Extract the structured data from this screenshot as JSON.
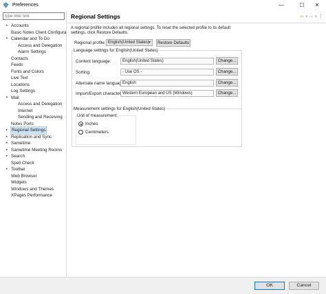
{
  "window": {
    "title": "Preferences",
    "minimize": "—",
    "maximize": "☐",
    "close": "✕"
  },
  "sidebar": {
    "filter_placeholder": "type filter text",
    "items": [
      {
        "label": "Accounts",
        "level": 1,
        "expander": "collapsed"
      },
      {
        "label": "Basic Notes Client Configura",
        "level": 1,
        "expander": "none"
      },
      {
        "label": "Calendar and To Do",
        "level": 1,
        "expander": "expanded"
      },
      {
        "label": "Access and Delegation",
        "level": 2,
        "expander": "none"
      },
      {
        "label": "Alarm Settings",
        "level": 2,
        "expander": "none"
      },
      {
        "label": "Contacts",
        "level": 1,
        "expander": "none"
      },
      {
        "label": "Feeds",
        "level": 1,
        "expander": "none"
      },
      {
        "label": "Fonts and Colors",
        "level": 1,
        "expander": "none"
      },
      {
        "label": "Live Text",
        "level": 1,
        "expander": "none"
      },
      {
        "label": "Locations",
        "level": 1,
        "expander": "none"
      },
      {
        "label": "Log Settings",
        "level": 1,
        "expander": "none"
      },
      {
        "label": "Mail",
        "level": 1,
        "expander": "expanded"
      },
      {
        "label": "Access and Delegation",
        "level": 2,
        "expander": "none"
      },
      {
        "label": "Internet",
        "level": 2,
        "expander": "none"
      },
      {
        "label": "Sending and Receiving",
        "level": 2,
        "expander": "none"
      },
      {
        "label": "Notes Ports",
        "level": 1,
        "expander": "none"
      },
      {
        "label": "Regional Settings",
        "level": 1,
        "expander": "collapsed",
        "selected": true
      },
      {
        "label": "Replication and Sync",
        "level": 1,
        "expander": "collapsed"
      },
      {
        "label": "Sametime",
        "level": 1,
        "expander": "collapsed"
      },
      {
        "label": "Sametime Meeting Rooms",
        "level": 1,
        "expander": "collapsed"
      },
      {
        "label": "Search",
        "level": 1,
        "expander": "collapsed"
      },
      {
        "label": "Spell Check",
        "level": 1,
        "expander": "none"
      },
      {
        "label": "Toolbar",
        "level": 1,
        "expander": "collapsed"
      },
      {
        "label": "Web Browser",
        "level": 1,
        "expander": "none"
      },
      {
        "label": "Widgets",
        "level": 1,
        "expander": "none"
      },
      {
        "label": "Windows and Themes",
        "level": 1,
        "expander": "none"
      },
      {
        "label": "XPages Performance",
        "level": 1,
        "expander": "none"
      }
    ]
  },
  "page": {
    "title": "Regional Settings",
    "nav_back": "⇦",
    "nav_dropdown": "▾",
    "nav_forward": "⇨",
    "nav_menu": "⋮",
    "description": "A regional profile includes all regional settings.  To reset the selected profile to its default settings, click Restore Defaults.",
    "profile_label": "Regional profile:",
    "profile_value": "English(United States)",
    "restore_button": "Restore Defaults",
    "language_group_title": "Language settings for English(United States)",
    "rows": [
      {
        "label": "Content language:",
        "value": "English(United States)",
        "button": "Change..."
      },
      {
        "label": "Sorting:",
        "value": "- Use OS -",
        "button": "Change..."
      },
      {
        "label": "Alternate name language:",
        "value": "English",
        "button": "Change..."
      },
      {
        "label": "Import/Export characters:",
        "value": "Western European and US (Windows)",
        "button": "Change..."
      }
    ],
    "measurement_group_title": "Measurement settings for English(United States)",
    "unit_label": "Unit of measurement:",
    "radios": [
      {
        "label": "Inches",
        "selected": true
      },
      {
        "label": "Centimeters",
        "selected": false
      }
    ]
  },
  "footer": {
    "ok": "OK",
    "cancel": "Cancel"
  }
}
